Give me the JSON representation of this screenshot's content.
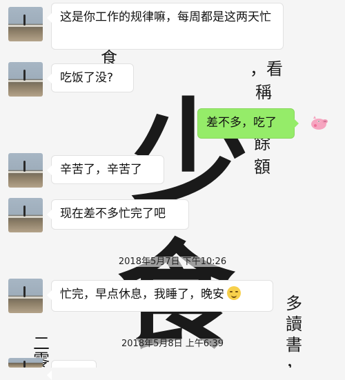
{
  "wallpaper": {
    "chars": [
      "食",
      "，看",
      "稱",
      "餘",
      "額",
      "多",
      "讀",
      "書",
      "，",
      "二",
      "零",
      "少",
      "食"
    ]
  },
  "messages": [
    {
      "side": "left",
      "text": "这是你工作的规律嘛，每周都是这两天忙"
    },
    {
      "side": "left",
      "text": "吃饭了没?"
    },
    {
      "side": "right",
      "text": "差不多，吃了"
    },
    {
      "side": "left",
      "text": "辛苦了，辛苦了"
    },
    {
      "side": "left",
      "text": "现在差不多忙完了吧"
    },
    {
      "side": "left",
      "text": "忙完，早点休息，我睡了，晚安"
    }
  ],
  "timestamps": [
    "2018年5月7日 下午10:26",
    "2018年5月8日 上午6:39"
  ],
  "icons": {
    "right_sticker": "peppa-pig-icon",
    "smile_emoji": "smiling-face-icon"
  }
}
